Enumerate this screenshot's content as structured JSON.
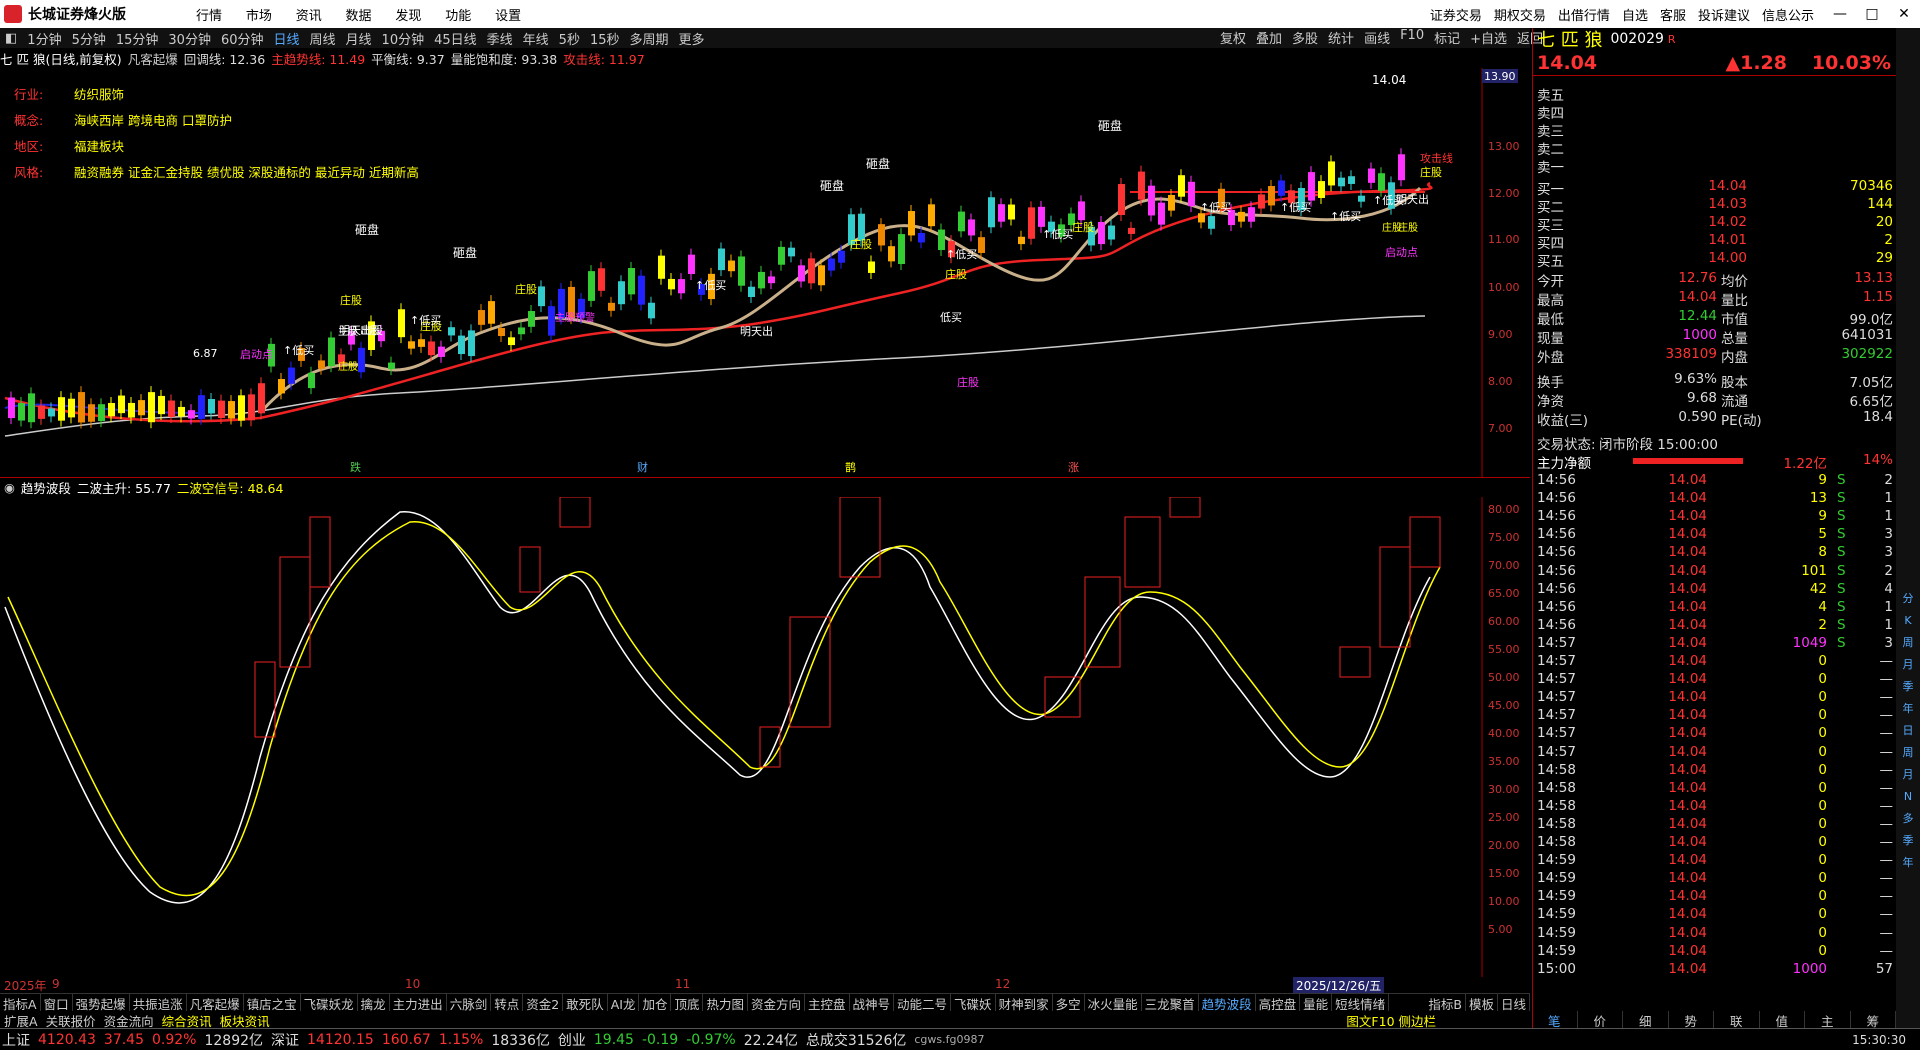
{
  "app": {
    "title": "长城证券烽火版"
  },
  "menu": [
    "行情",
    "市场",
    "资讯",
    "数据",
    "发现",
    "功能",
    "设置"
  ],
  "top_right": [
    "证券交易",
    "期权交易",
    "出借行情",
    "自选",
    "客服",
    "投诉建议",
    "信息公示"
  ],
  "periods": [
    "1分钟",
    "5分钟",
    "15分钟",
    "30分钟",
    "60分钟",
    "日线",
    "周线",
    "月线",
    "10分钟",
    "45日线",
    "季线",
    "年线",
    "5秒",
    "15秒",
    "多周期",
    "更多"
  ],
  "active_period": "日线",
  "chart_tools": [
    "复权",
    "叠加",
    "多股",
    "统计",
    "画线",
    "F10",
    "标记",
    "+自选",
    "返回"
  ],
  "info": {
    "stock": "七 匹 狼(日线,前复权)",
    "indicator": "凡客起爆",
    "l1": "回调线: 12.36",
    "l2": "主趋势线: 11.49",
    "l3": "平衡线: 9.37",
    "l4": "量能饱和度: 93.38",
    "l5": "攻击线: 11.97"
  },
  "profile": [
    {
      "k": "行业:",
      "v": "纺织服饰"
    },
    {
      "k": "概念:",
      "v": "海峡西岸 跨境电商 口罩防护"
    },
    {
      "k": "地区:",
      "v": "福建板块"
    },
    {
      "k": "风格:",
      "v": "融资融券 证金汇金持股 绩优股 深股通标的 最近异动 近期新高"
    }
  ],
  "price_axis": [
    "13.00",
    "12.00",
    "11.00",
    "10.00",
    "9.00",
    "8.00",
    "7.00"
  ],
  "price_tag": "13.90",
  "high_label": "14.04",
  "low_label": "6.87",
  "marks": [
    "跌",
    "财",
    "鹊",
    "涨"
  ],
  "sub": {
    "name": "趋势波段",
    "l1": "二波主升: 55.77",
    "l2": "二波空信号: 48.64"
  },
  "sub_axis": [
    "80.00",
    "75.00",
    "70.00",
    "65.00",
    "60.00",
    "55.00",
    "50.00",
    "45.00",
    "40.00",
    "35.00",
    "30.00",
    "25.00",
    "20.00",
    "15.00",
    "10.00",
    "5.00"
  ],
  "dates": [
    "2025年",
    "9",
    "10",
    "11",
    "12",
    "2025/12/26/五"
  ],
  "indicators": [
    "指标A",
    "窗口",
    "强势起爆",
    "共振追涨",
    "凡客起爆",
    "镇店之宝",
    "飞碟妖龙",
    "擒龙",
    "主力进出",
    "六脉剑",
    "转点",
    "资金2",
    "敢死队",
    "AI龙",
    "加仓",
    "顶底",
    "热力图",
    "资金方向",
    "主控盘",
    "战神号",
    "动能二号",
    "飞碟妖",
    "财神到家",
    "多空",
    "冰火量能",
    "三龙聚首",
    "趋势波段",
    "高控盘",
    "量能",
    "短线情绪"
  ],
  "indicators_right": [
    "指标B",
    "模板",
    "日线"
  ],
  "indicators2": [
    "扩展A",
    "关联报价",
    "资金流向",
    "综合资讯",
    "板块资讯"
  ],
  "f10_link": "图文F10 侧边栏",
  "quote": {
    "name": "七 匹 狼",
    "code": "002029",
    "badge": "R",
    "price": "14.04",
    "chg": "▲1.28",
    "pct": "10.03%",
    "sells": [
      "卖五",
      "卖四",
      "卖三",
      "卖二",
      "卖一"
    ],
    "buys": [
      {
        "k": "买一",
        "p": "14.04",
        "v": "70346"
      },
      {
        "k": "买二",
        "p": "14.03",
        "v": "144"
      },
      {
        "k": "买三",
        "p": "14.02",
        "v": "20"
      },
      {
        "k": "买四",
        "p": "14.01",
        "v": "2"
      },
      {
        "k": "买五",
        "p": "14.00",
        "v": "29"
      }
    ],
    "stats": [
      {
        "a": "今开",
        "b": "12.76",
        "c": "均价",
        "d": "13.13"
      },
      {
        "a": "最高",
        "b": "14.04",
        "c": "量比",
        "d": "1.15"
      },
      {
        "a": "最低",
        "b": "12.44",
        "c": "市值",
        "d": "99.0亿"
      },
      {
        "a": "现量",
        "b": "1000",
        "c": "总量",
        "d": "641031"
      },
      {
        "a": "外盘",
        "b": "338109",
        "c": "内盘",
        "d": "302922"
      },
      {
        "a": "换手",
        "b": "9.63%",
        "c": "股本",
        "d": "7.05亿"
      },
      {
        "a": "净资",
        "b": "9.68",
        "c": "流通",
        "d": "6.65亿"
      },
      {
        "a": "收益(三)",
        "b": "0.590",
        "c": "PE(动)",
        "d": "18.4"
      }
    ],
    "status_label": "交易状态:",
    "status_val": "闭市阶段 15:00:00",
    "flow_label": "主力净额",
    "flow_val": "1.22亿",
    "flow_pct": "14%"
  },
  "ticks": [
    {
      "t": "14:56",
      "p": "14.04",
      "v": "9",
      "s": "S",
      "n": "2"
    },
    {
      "t": "14:56",
      "p": "14.04",
      "v": "13",
      "s": "S",
      "n": "1"
    },
    {
      "t": "14:56",
      "p": "14.04",
      "v": "9",
      "s": "S",
      "n": "1"
    },
    {
      "t": "14:56",
      "p": "14.04",
      "v": "5",
      "s": "S",
      "n": "3"
    },
    {
      "t": "14:56",
      "p": "14.04",
      "v": "8",
      "s": "S",
      "n": "3"
    },
    {
      "t": "14:56",
      "p": "14.04",
      "v": "101",
      "s": "S",
      "n": "2"
    },
    {
      "t": "14:56",
      "p": "14.04",
      "v": "42",
      "s": "S",
      "n": "4"
    },
    {
      "t": "14:56",
      "p": "14.04",
      "v": "4",
      "s": "S",
      "n": "1"
    },
    {
      "t": "14:56",
      "p": "14.04",
      "v": "2",
      "s": "S",
      "n": "1"
    },
    {
      "t": "14:57",
      "p": "14.04",
      "v": "1049",
      "s": "S",
      "n": "3"
    },
    {
      "t": "14:57",
      "p": "14.04",
      "v": "0",
      "s": "",
      "n": "—"
    },
    {
      "t": "14:57",
      "p": "14.04",
      "v": "0",
      "s": "",
      "n": "—"
    },
    {
      "t": "14:57",
      "p": "14.04",
      "v": "0",
      "s": "",
      "n": "—"
    },
    {
      "t": "14:57",
      "p": "14.04",
      "v": "0",
      "s": "",
      "n": "—"
    },
    {
      "t": "14:57",
      "p": "14.04",
      "v": "0",
      "s": "",
      "n": "—"
    },
    {
      "t": "14:57",
      "p": "14.04",
      "v": "0",
      "s": "",
      "n": "—"
    },
    {
      "t": "14:58",
      "p": "14.04",
      "v": "0",
      "s": "",
      "n": "—"
    },
    {
      "t": "14:58",
      "p": "14.04",
      "v": "0",
      "s": "",
      "n": "—"
    },
    {
      "t": "14:58",
      "p": "14.04",
      "v": "0",
      "s": "",
      "n": "—"
    },
    {
      "t": "14:58",
      "p": "14.04",
      "v": "0",
      "s": "",
      "n": "—"
    },
    {
      "t": "14:58",
      "p": "14.04",
      "v": "0",
      "s": "",
      "n": "—"
    },
    {
      "t": "14:59",
      "p": "14.04",
      "v": "0",
      "s": "",
      "n": "—"
    },
    {
      "t": "14:59",
      "p": "14.04",
      "v": "0",
      "s": "",
      "n": "—"
    },
    {
      "t": "14:59",
      "p": "14.04",
      "v": "0",
      "s": "",
      "n": "—"
    },
    {
      "t": "14:59",
      "p": "14.04",
      "v": "0",
      "s": "",
      "n": "—"
    },
    {
      "t": "14:59",
      "p": "14.04",
      "v": "0",
      "s": "",
      "n": "—"
    },
    {
      "t": "14:59",
      "p": "14.04",
      "v": "0",
      "s": "",
      "n": "—"
    },
    {
      "t": "15:00",
      "p": "14.04",
      "v": "1000",
      "s": "",
      "n": "57"
    }
  ],
  "bottom_tabs": [
    "笔",
    "价",
    "细",
    "势",
    "联",
    "值",
    "主",
    "筹"
  ],
  "status": {
    "sh": "上证",
    "sh_v": "4120.43",
    "sh_c": "37.45",
    "sh_p": "0.92%",
    "sh_a": "12892亿",
    "sz": "深证",
    "sz_v": "14120.15",
    "sz_c": "160.67",
    "sz_p": "1.15%",
    "sz_a": "18336亿",
    "cy": "创业",
    "cy_v": "19.45",
    "cy_c": "-0.19",
    "cy_p": "-0.97%",
    "cy_a": "22.24亿",
    "total": "总成交31526亿",
    "srv": "cgws.fg0987",
    "time": "15:30:30"
  },
  "side": [
    "分",
    "K",
    "周",
    "月",
    "季",
    "年",
    "日",
    "周",
    "月",
    "N",
    "多",
    "季",
    "年"
  ]
}
